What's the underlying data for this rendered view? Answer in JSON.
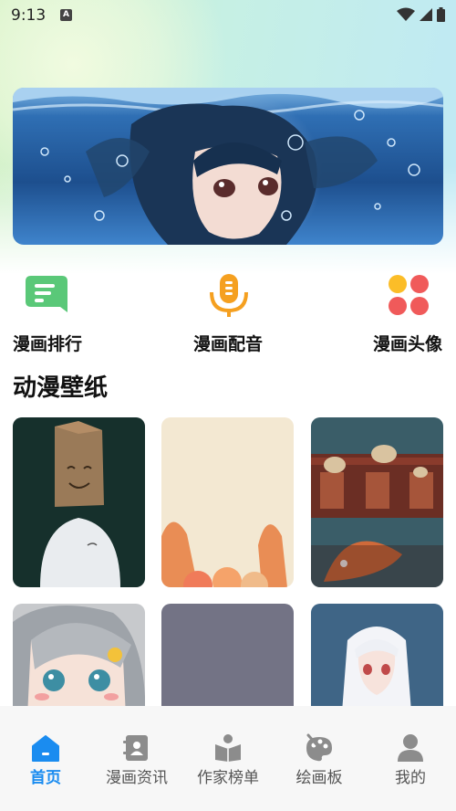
{
  "status_bar": {
    "time": "9:13",
    "notification_letter": "A"
  },
  "banner": {
    "image": "underwater-anime-girl"
  },
  "quick_nav": [
    {
      "label": "漫画排行",
      "icon": "chat-list-icon",
      "color": "#5ac878"
    },
    {
      "label": "漫画配音",
      "icon": "microphone-icon",
      "color": "#f5a020"
    },
    {
      "label": "漫画头像",
      "icon": "grid-dots-icon",
      "color": "#f05a5a"
    }
  ],
  "section": {
    "title": "动漫壁纸"
  },
  "wallpapers": [
    {
      "image": "paper-bag-boy"
    },
    {
      "image": "pastel-bunny-ears"
    },
    {
      "image": "koi-fish-festival"
    },
    {
      "image": "silver-hair-anime-girl"
    },
    {
      "image": "gray-blank"
    },
    {
      "image": "white-hair-girl-rain"
    }
  ],
  "tab_bar": {
    "tabs": [
      {
        "label": "首页",
        "icon": "home-icon",
        "active": true
      },
      {
        "label": "漫画资讯",
        "icon": "contact-book-icon",
        "active": false
      },
      {
        "label": "作家榜单",
        "icon": "reader-book-icon",
        "active": false
      },
      {
        "label": "绘画板",
        "icon": "palette-icon",
        "active": false
      },
      {
        "label": "我的",
        "icon": "user-icon",
        "active": false
      }
    ],
    "active_color": "#1a8cf0"
  }
}
